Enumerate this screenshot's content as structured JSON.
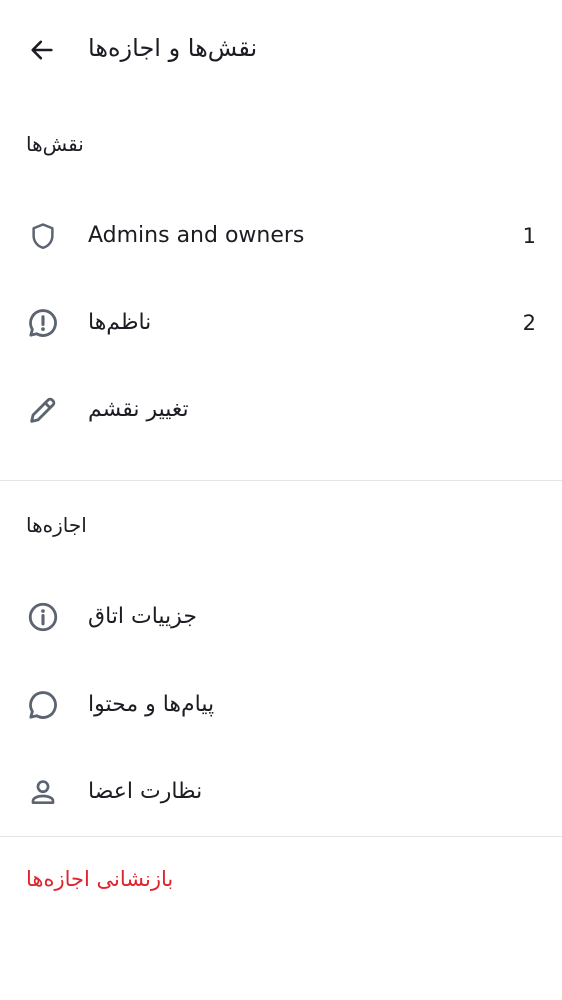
{
  "header": {
    "title": "نقش‌ها و اجازه‌ها",
    "back_icon": "arrow-left-icon"
  },
  "roles_section": {
    "title": "نقش‌ها",
    "items": [
      {
        "icon": "shield-icon",
        "label": "Admins and owners",
        "count": "1"
      },
      {
        "icon": "alert-message-icon",
        "label": "ناظم‌ها",
        "count": "2"
      },
      {
        "icon": "pencil-icon",
        "label": "تغییر نقشم",
        "count": ""
      }
    ]
  },
  "permissions_section": {
    "title": "اجازه‌ها",
    "items": [
      {
        "icon": "info-icon",
        "label": "جزییات اتاق"
      },
      {
        "icon": "message-bubble-icon",
        "label": "پیام‌ها و محتوا"
      },
      {
        "icon": "user-icon",
        "label": "نظارت اعضا"
      }
    ]
  },
  "reset": {
    "label": "بازنشانی اجازه‌ها"
  },
  "colors": {
    "text": "#1b1d22",
    "icon": "#5c6470",
    "divider": "#e3e5e8",
    "danger": "#e0242c",
    "background": "#ffffff"
  }
}
